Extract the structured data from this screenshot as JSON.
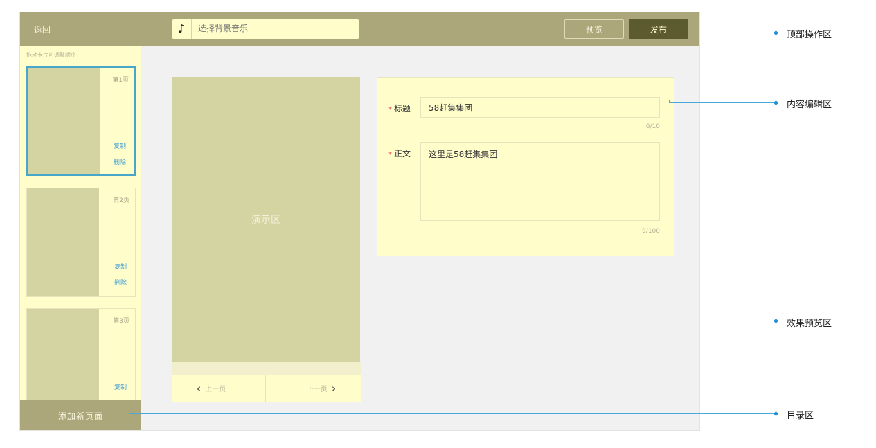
{
  "topbar": {
    "back_label": "返回",
    "music_icon": "music-note-icon",
    "music_glyph": "♪",
    "music_placeholder": "选择背景音乐",
    "preview_label": "预览",
    "publish_label": "发布"
  },
  "sidebar": {
    "hint": "拖动卡片可调整顺序",
    "cards": [
      {
        "page": "第1页",
        "copy": "复制",
        "delete": "删除",
        "selected": true
      },
      {
        "page": "第2页",
        "copy": "复制",
        "delete": "删除",
        "selected": false
      },
      {
        "page": "第3页",
        "copy": "复制",
        "delete": "",
        "selected": false
      }
    ],
    "add_page_label": "添加新页面"
  },
  "stage": {
    "label": "演示区",
    "prev_label": "上一页",
    "next_label": "下一页"
  },
  "editor": {
    "title_label": "标题",
    "title_value": "58赶集集团",
    "title_counter": "6/10",
    "body_label": "正文",
    "body_value": "这里是58赶集集团",
    "body_counter": "9/100"
  },
  "annotations": {
    "top": "顶部操作区",
    "content": "内容编辑区",
    "preview": "效果预览区",
    "catalog": "目录区"
  },
  "colors": {
    "bar": "#aca77a",
    "panel": "#fffecb",
    "block": "#d4d3a2",
    "publish": "#5c5a2f",
    "accent": "#47a6c9",
    "link": "#3f9bd4"
  }
}
